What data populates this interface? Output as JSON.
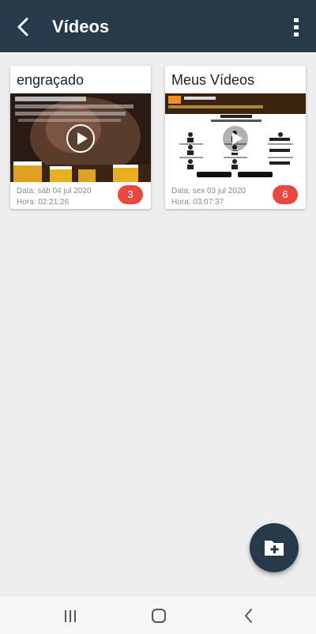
{
  "app_bar": {
    "title": "Vídeos",
    "back_icon": "chevron-left-icon",
    "menu_icon": "more-vertical-icon"
  },
  "albums": [
    {
      "title": "engraçado",
      "date": "Data: sáb 04 jul 2020",
      "time": "Hora: 02:21:26",
      "count": "3"
    },
    {
      "title": "Meus Vídeos",
      "date": "Data: sex 03 jul 2020",
      "time": "Hora: 03:07:37",
      "count": "6"
    }
  ],
  "fab": {
    "icon": "add-folder-icon"
  },
  "navigation_bar": {
    "items": [
      "recent-apps-icon",
      "home-icon",
      "back-icon"
    ]
  },
  "colors": {
    "primary": "#263a4b",
    "badge": "#e8483f",
    "background": "#eeeeee"
  }
}
